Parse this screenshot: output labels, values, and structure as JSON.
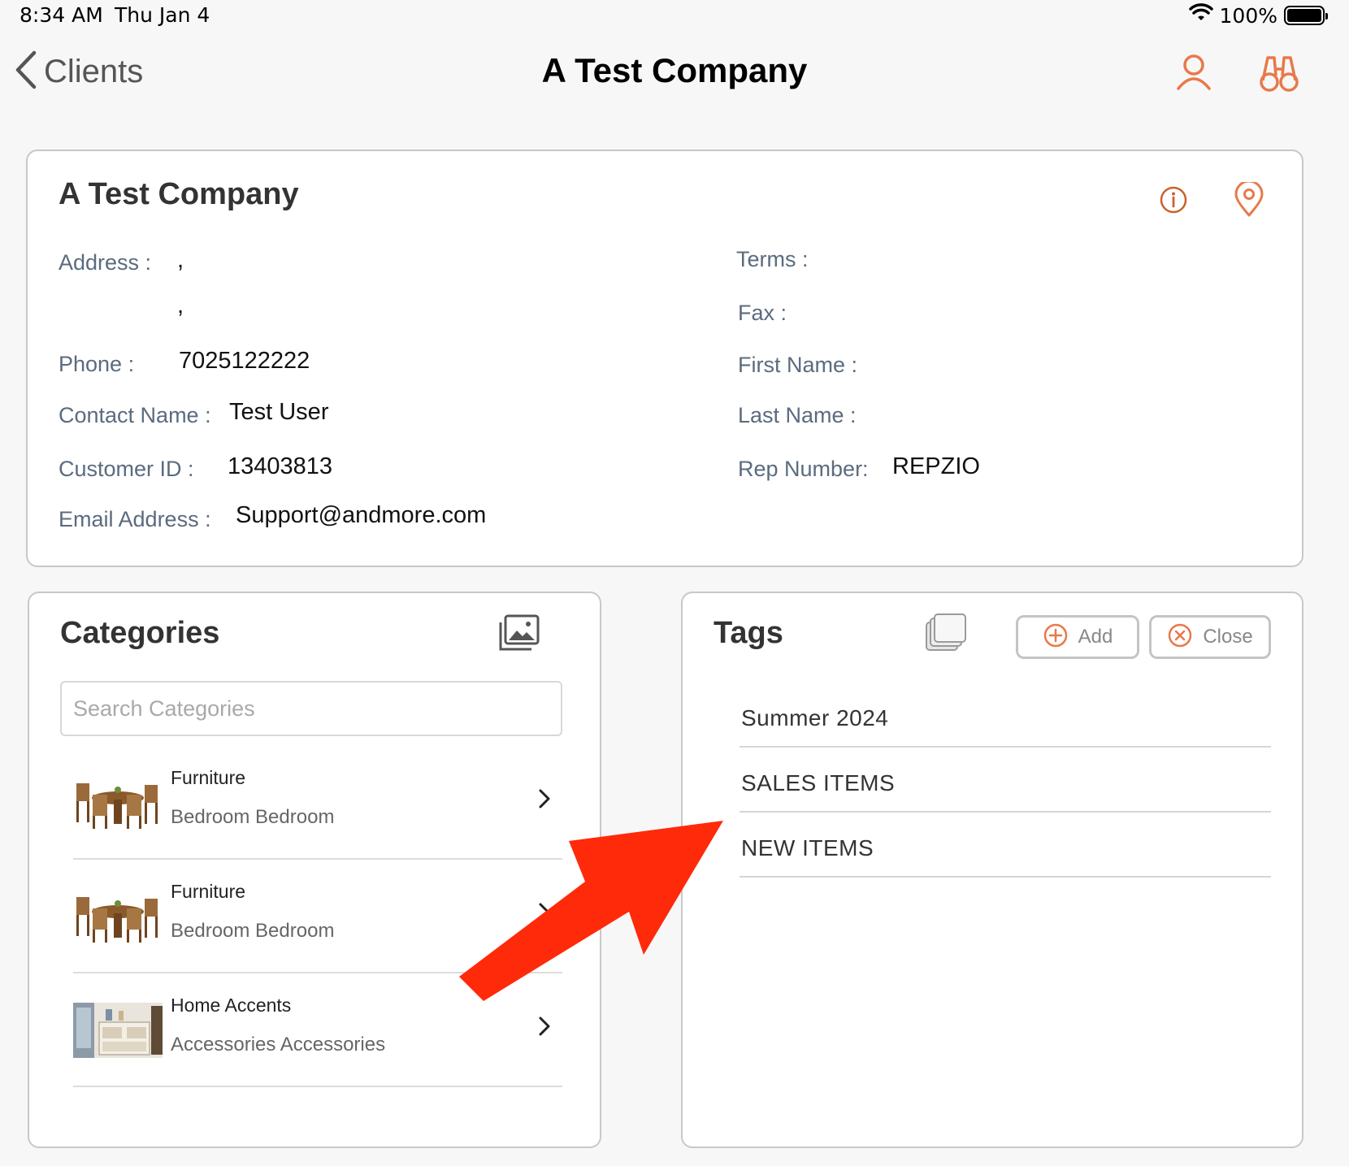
{
  "status_bar": {
    "time": "8:34 AM",
    "date": "Thu Jan 4",
    "battery_text": "100%",
    "icons": [
      "wifi-icon",
      "battery-icon"
    ]
  },
  "nav": {
    "back_label": "Clients",
    "title": "A Test Company",
    "icons": [
      "user-icon",
      "binoculars-icon"
    ]
  },
  "client": {
    "name": "A Test Company",
    "fields": {
      "address_label": "Address :",
      "address_line1": ",",
      "address_line2": ",",
      "phone_label": "Phone :",
      "phone_value": "7025122222",
      "contact_label": "Contact Name :",
      "contact_value": "Test User",
      "customer_id_label": "Customer ID :",
      "customer_id_value": "13403813",
      "email_label": "Email Address :",
      "email_value": "Support@andmore.com",
      "terms_label": "Terms :",
      "fax_label": "Fax :",
      "first_name_label": "First Name :",
      "last_name_label": "Last Name :",
      "rep_label": "Rep Number:",
      "rep_value": "REPZIO"
    },
    "icons": [
      "info-icon",
      "location-pin-icon"
    ]
  },
  "categories": {
    "title": "Categories",
    "search_placeholder": "Search Categories",
    "items": [
      {
        "name": "Furniture",
        "subtitle": "Bedroom Bedroom",
        "thumb": "dining-set-image"
      },
      {
        "name": "Furniture",
        "subtitle": "Bedroom Bedroom",
        "thumb": "dining-set-image"
      },
      {
        "name": "Home Accents",
        "subtitle": "Accessories Accessories",
        "thumb": "room-interior-image"
      }
    ]
  },
  "tags": {
    "title": "Tags",
    "add_label": "Add",
    "close_label": "Close",
    "items": [
      "Summer 2024",
      "SALES ITEMS",
      "NEW ITEMS"
    ]
  },
  "colors": {
    "accent": "#e8794a",
    "label": "#5b6b7e",
    "annotation_arrow": "#ff2a0a"
  }
}
